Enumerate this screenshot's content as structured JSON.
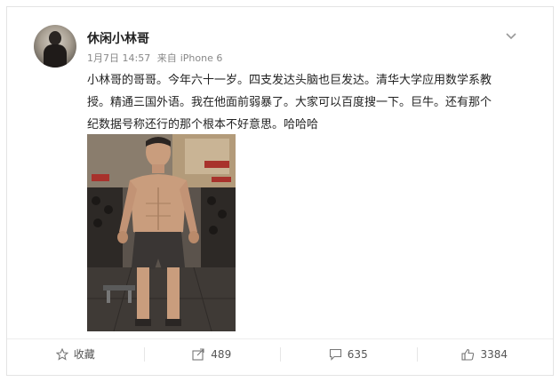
{
  "post": {
    "username": "休闲小林哥",
    "date": "1月7日 14:57",
    "source_prefix": "来自",
    "source": "iPhone 6",
    "text_lines": [
      "小林哥的哥哥。今年六十一岁。四支发达头脑也巨发达。清华大学应用数学系教",
      "授。精通三国外语。我在他面前弱暴了。大家可以百度搜一下。巨牛。还有那个",
      "纪数据号称还行的那个根本不好意思。哈哈哈"
    ]
  },
  "actions": {
    "favorite_label": "收藏",
    "repost_count": "489",
    "comment_count": "635",
    "like_count": "3384"
  },
  "icons": {
    "avatar": "avatar",
    "menu": "chevron-down-icon",
    "favorite": "star-icon",
    "repost": "repost-icon",
    "comment": "comment-icon",
    "like": "thumbs-up-icon"
  }
}
